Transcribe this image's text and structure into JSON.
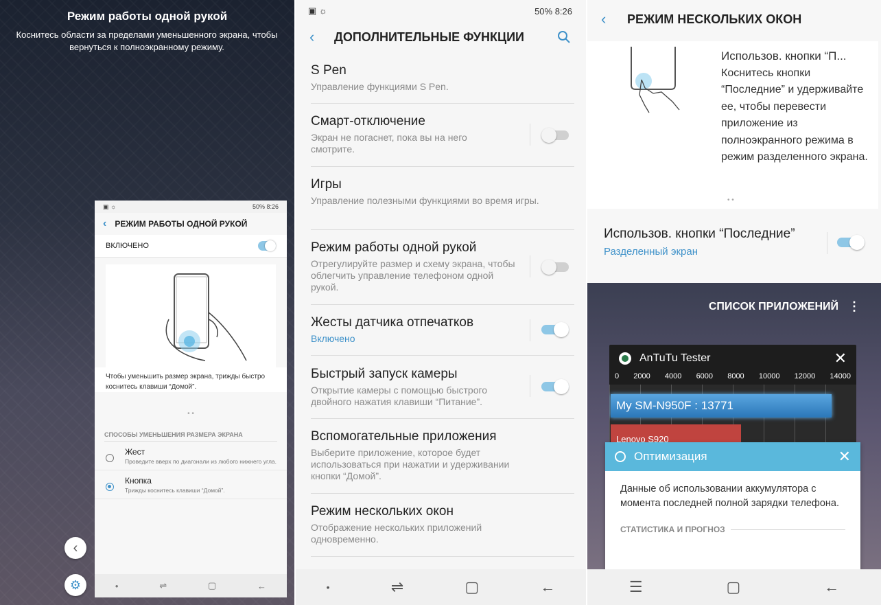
{
  "one_hand": {
    "title": "Режим работы одной рукой",
    "subtitle": "Коснитесь области за пределами уменьшенного экрана, чтобы вернуться к полноэкранному режиму.",
    "mini": {
      "status_right": "50% 8:26",
      "header": "РЕЖИМ РАБОТЫ ОДНОЙ РУКОЙ",
      "enabled_label": "ВКЛЮЧЕНО",
      "hint": "Чтобы уменьшить размер экрана, трижды быстро коснитесь клавиши “Домой”.",
      "section": "СПОСОБЫ УМЕНЬШЕНИЯ РАЗМЕРА ЭКРАНА",
      "options": [
        {
          "label": "Жест",
          "desc": "Проведите вверх по диагонали из любого нижнего угла."
        },
        {
          "label": "Кнопка",
          "desc": "Трижды коснитесь клавиши “Домой”."
        }
      ]
    }
  },
  "settings": {
    "status_right": "50% 8:26",
    "header": "ДОПОЛНИТЕЛЬНЫЕ ФУНКЦИИ",
    "items": [
      {
        "label": "S Pen",
        "desc": "Управление функциями S Pen."
      },
      {
        "label": "Смарт-отключение",
        "desc": "Экран не погаснет, пока вы на него смотрите."
      },
      {
        "label": "Игры",
        "desc": "Управление полезными функциями во время игры."
      },
      {
        "label": "Режим работы одной рукой",
        "desc": "Отрегулируйте размер и схему экрана, чтобы облегчить управление телефоном одной рукой."
      },
      {
        "label": "Жесты датчика отпечатков",
        "desc": "Включено"
      },
      {
        "label": "Быстрый запуск камеры",
        "desc": "Открытие камеры с помощью быстрого двойного нажатия клавиши “Питание”."
      },
      {
        "label": "Вспомогательные приложения",
        "desc": "Выберите приложение, которое будет использоваться при нажатии и удерживании кнопки “Домой”."
      },
      {
        "label": "Режим нескольких окон",
        "desc": "Отображение нескольких приложений одновременно."
      }
    ]
  },
  "multiwindow": {
    "header": "РЕЖИМ НЕСКОЛЬКИХ ОКОН",
    "card_title": "Использов. кнопки “П...",
    "card_text": "Коснитесь кнопки “Последние” и удерживайте ее, чтобы перевести приложение из полноэкранного режима в режим разделенного экрана.",
    "row_label": "Использов. кнопки “Последние”",
    "row_sub": "Разделенный экран",
    "app_list": "СПИСОК ПРИЛОЖЕНИЙ",
    "antutu": {
      "title": "AnTuTu Tester",
      "axis": [
        "0",
        "2000",
        "4000",
        "6000",
        "8000",
        "10000",
        "12000",
        "14000"
      ],
      "bar1": "My SM-N950F :  13771",
      "bar2": "Lenovo S920"
    },
    "optimization": {
      "title": "Оптимизация",
      "body": "Данные об использовании аккумулятора с момента последней полной зарядки телефона.",
      "section": "СТАТИСТИКА И ПРОГНОЗ"
    }
  }
}
